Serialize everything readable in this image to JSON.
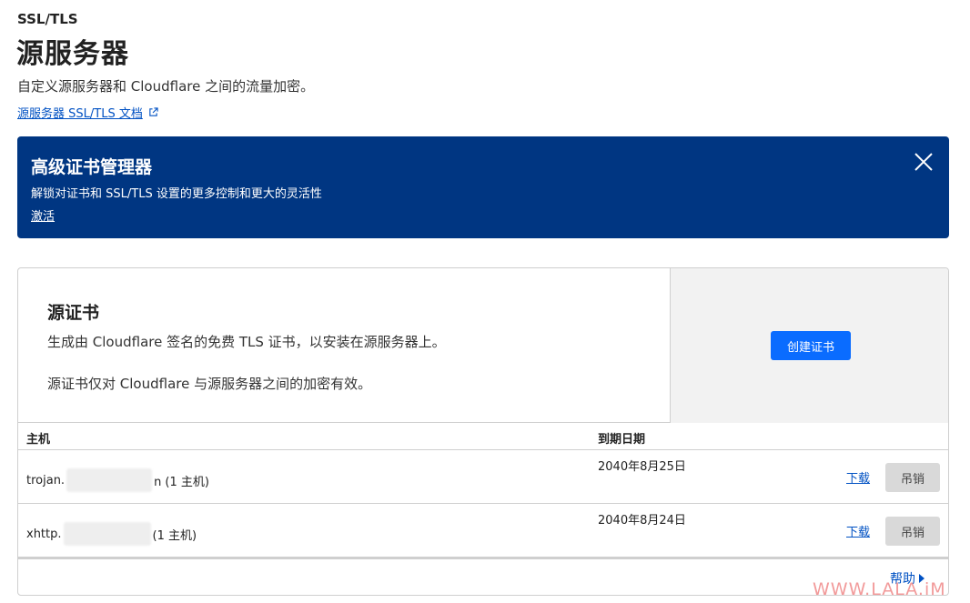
{
  "header": {
    "eyebrow": "SSL/TLS",
    "title": "源服务器",
    "description": "自定义源服务器和 Cloudflare 之间的流量加密。",
    "doc_link": "源服务器 SSL/TLS 文档",
    "doc_link_icon": "external-link-icon"
  },
  "banner": {
    "title": "高级证书管理器",
    "subtitle": "解锁对证书和 SSL/TLS 设置的更多控制和更大的灵活性",
    "link": "激活",
    "close_icon": "close-icon",
    "background": "#003682"
  },
  "origin_cert": {
    "title": "源证书",
    "line1": "生成由 Cloudflare 签名的免费 TLS 证书，以安装在源服务器上。",
    "line2": "源证书仅对 Cloudflare 与源服务器之间的加密有效。",
    "create_button": "创建证书",
    "accent": "#0a6cff"
  },
  "table": {
    "col_host": "主机",
    "col_expiry": "到期日期",
    "rows": [
      {
        "host_prefix": "trojan.",
        "host_suffix": "n (1 主机)",
        "expiry": "2040年8月25日",
        "download": "下载",
        "revoke": "吊销"
      },
      {
        "host_prefix": "xhttp.",
        "host_suffix": "(1 主机)",
        "expiry": "2040年8月24日",
        "download": "下载",
        "revoke": "吊销"
      }
    ]
  },
  "footer": {
    "help": "帮助"
  },
  "watermark": "WWW.LALA.iM"
}
